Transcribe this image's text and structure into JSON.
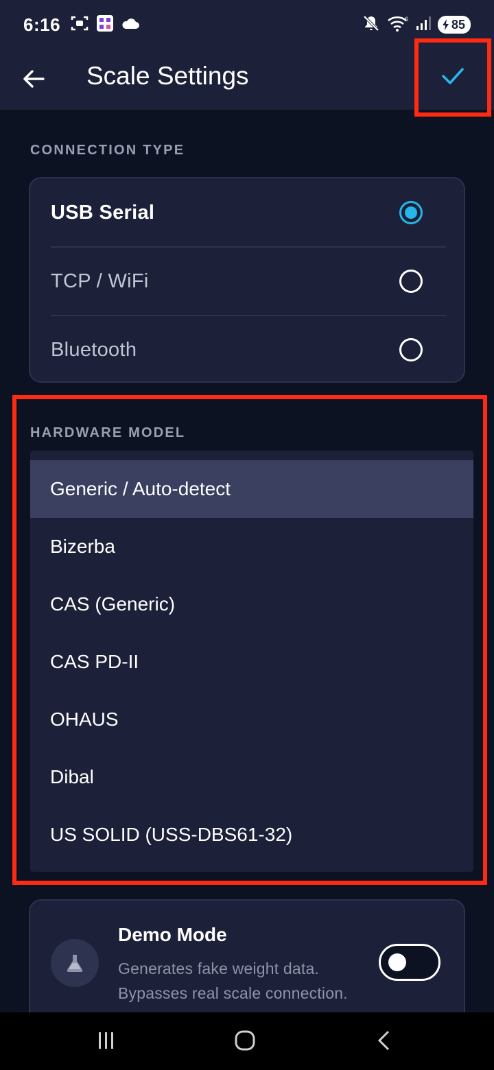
{
  "status_bar": {
    "time": "6:16",
    "battery": "85",
    "icons": [
      "screenshot-icon",
      "qr-app-icon",
      "cloud-icon",
      "mute-icon",
      "wifi-icon",
      "signal-icon",
      "battery-icon"
    ]
  },
  "app_bar": {
    "title": "Scale Settings",
    "back_icon": "arrow-left-icon",
    "confirm_icon": "check-icon"
  },
  "connection": {
    "header": "CONNECTION TYPE",
    "options": [
      {
        "label": "USB Serial",
        "selected": true
      },
      {
        "label": "TCP / WiFi",
        "selected": false
      },
      {
        "label": "Bluetooth",
        "selected": false
      }
    ]
  },
  "hardware": {
    "header": "HARDWARE MODEL",
    "options": [
      {
        "label": "Generic / Auto-detect",
        "highlighted": true
      },
      {
        "label": "Bizerba",
        "highlighted": false
      },
      {
        "label": "CAS (Generic)",
        "highlighted": false
      },
      {
        "label": "CAS PD-II",
        "highlighted": false
      },
      {
        "label": "OHAUS",
        "highlighted": false
      },
      {
        "label": "Dibal",
        "highlighted": false
      },
      {
        "label": "US SOLID (USS-DBS61-32)",
        "highlighted": false
      }
    ]
  },
  "demo": {
    "title": "Demo Mode",
    "desc_line1": "Generates fake weight data.",
    "desc_line2": "Bypasses real scale connection.",
    "enabled": false,
    "icon": "flask-icon"
  },
  "colors": {
    "accent": "#27b6ea",
    "annotation_red": "#ff2a12",
    "surface": "#1c2038",
    "background": "#0d1223"
  }
}
